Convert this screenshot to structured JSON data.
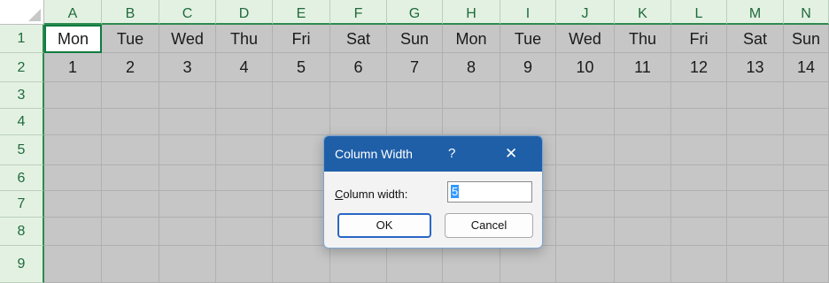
{
  "columns": [
    "A",
    "B",
    "C",
    "D",
    "E",
    "F",
    "G",
    "H",
    "I",
    "J",
    "K",
    "L",
    "M",
    "N"
  ],
  "rows": [
    "1",
    "2",
    "3",
    "4",
    "5",
    "6",
    "7",
    "8",
    "9"
  ],
  "row1": [
    "Mon",
    "Tue",
    "Wed",
    "Thu",
    "Fri",
    "Sat",
    "Sun",
    "Mon",
    "Tue",
    "Wed",
    "Thu",
    "Fri",
    "Sat",
    "Sun"
  ],
  "row2": [
    "1",
    "2",
    "3",
    "4",
    "5",
    "6",
    "7",
    "8",
    "9",
    "10",
    "11",
    "12",
    "13",
    "14"
  ],
  "colors": {
    "header_bg": "#e3f1e3",
    "header_text": "#1f6b3a",
    "cell_bg": "#c6c6c6",
    "dialog_title_bg": "#1f5fa8",
    "accent": "#107c41"
  },
  "dialog": {
    "title": "Column Width",
    "help": "?",
    "close": "✕",
    "field_label": "Column width:",
    "field_value": "5",
    "ok_label": "OK",
    "cancel_label": "Cancel"
  }
}
